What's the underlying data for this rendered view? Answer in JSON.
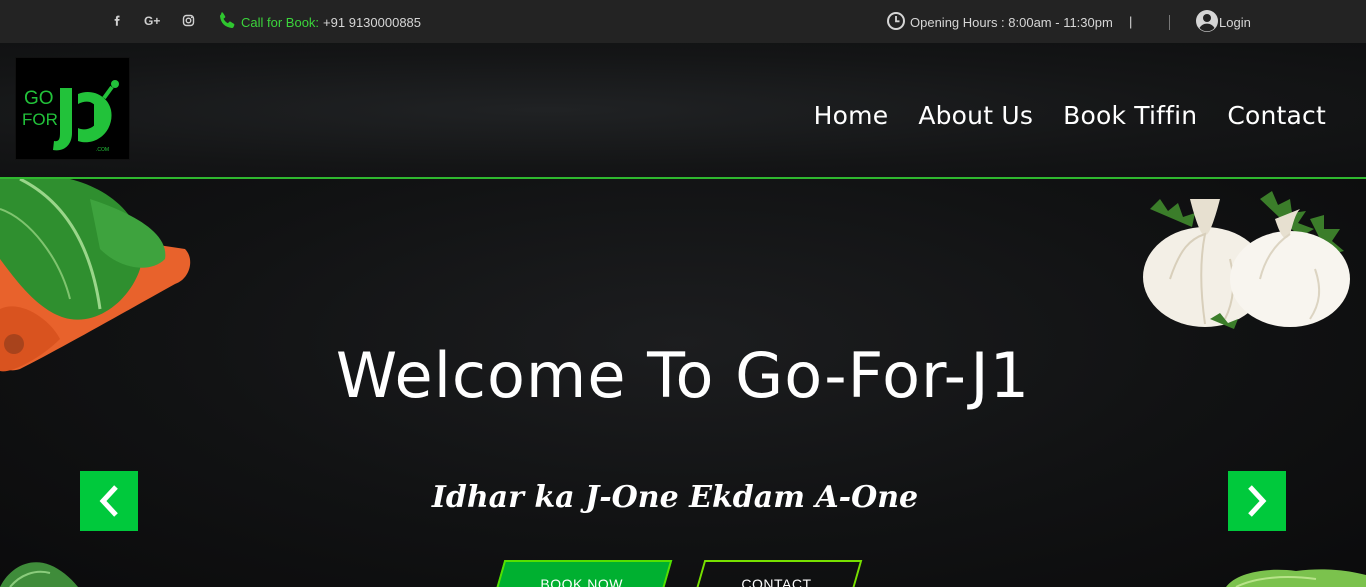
{
  "topbar": {
    "social_icons": [
      "facebook-icon",
      "google-plus-icon",
      "instagram-icon"
    ],
    "phone_label": "Call for Book:",
    "phone_number": "+91 9130000885",
    "hours": "Opening Hours : 8:00am - 11:30pm",
    "divider": "|",
    "login": "Login"
  },
  "header": {
    "logo_text_go": "GO",
    "logo_text_for": "FOR",
    "logo_text_j1": "J1",
    "nav": [
      "Home",
      "About Us",
      "Book Tiffin",
      "Contact"
    ]
  },
  "hero": {
    "title": "Welcome To Go-For-J1",
    "tagline": "Idhar ka J-One Ekdam A-One",
    "book_button": "BOOK NOW",
    "contact_button": "CONTACT"
  },
  "colors": {
    "accent_green": "#00c93c",
    "topbar_bg": "#232323",
    "phone_label_green": "#3bd43b",
    "cta_border": "#55e000"
  }
}
